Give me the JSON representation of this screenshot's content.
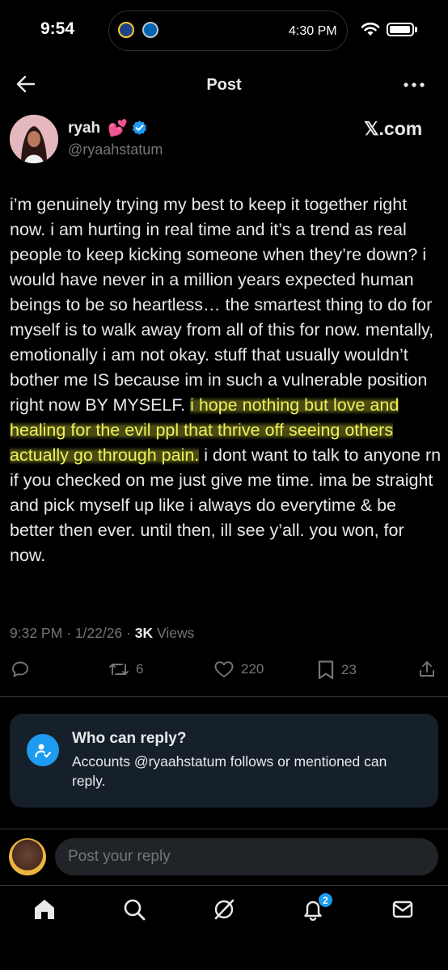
{
  "status_bar": {
    "time": "9:54",
    "island_time": "4:30 PM",
    "island_icons": [
      "basketball-team-icon",
      "basketball-team-icon"
    ]
  },
  "header": {
    "title": "Post",
    "back_icon": "arrow-left-icon",
    "more_icon": "more-horizontal-icon"
  },
  "author": {
    "name": "ryah",
    "emoji": "💕",
    "verified": true,
    "handle": "@ryaahstatum",
    "source_label": "𝕏.com"
  },
  "post": {
    "text_before": "i’m genuinely trying my best to keep it together right now. i am hurting in real time and it’s a trend as real people to keep kicking someone when they’re down? i would have never in a million years expected human beings to be so heartless… the smartest thing to do for myself is to walk away from all of this for now. mentally, emotionally i am not okay. stuff that usually wouldn’t bother me IS because im in such a vulnerable position right now BY MYSELF. ",
    "text_highlighted": "i hope nothing but love and healing for the evil ppl that thrive off seeing others actually go through pain.",
    "text_after": " i dont want to talk to anyone rn if you checked on me just give me time. ima be straight and pick myself up like i always do everytime & be better then ever. until then, ill see y’all. you won, for now.",
    "highlight_color": "#e2e83c"
  },
  "meta": {
    "time": "9:32 PM",
    "separator": "·",
    "date": "1/22/26",
    "views_count": "3K",
    "views_label": "Views"
  },
  "actions": {
    "reply_count": "",
    "retweet_count": "6",
    "like_count": "220",
    "bookmark_count": "23"
  },
  "who_can_reply": {
    "title": "Who can reply?",
    "text": "Accounts @ryaahstatum follows or mentioned can reply."
  },
  "compose": {
    "placeholder": "Post your reply"
  },
  "tab_bar": {
    "items": [
      "home-icon",
      "search-icon",
      "grok-icon",
      "notifications-icon",
      "messages-icon"
    ],
    "notifications_badge": "2"
  },
  "colors": {
    "background": "#000000",
    "text": "#e7e9ea",
    "muted": "#71767b",
    "accent": "#1d9bf0",
    "card": "#16202a"
  }
}
